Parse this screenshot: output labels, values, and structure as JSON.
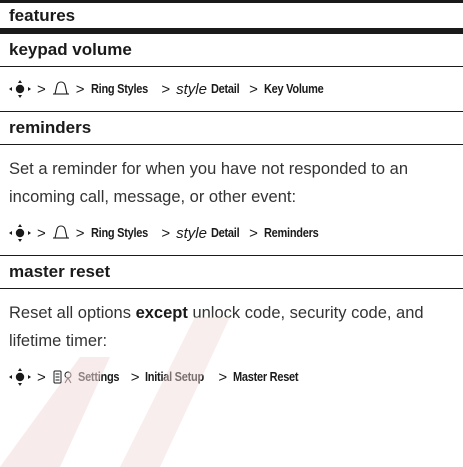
{
  "header": {
    "title": "features"
  },
  "sections": [
    {
      "title": "keypad volume",
      "body": "",
      "path": {
        "menu": "Ring Styles",
        "style_word": "style",
        "detail": "Detail",
        "target": "Key Volume"
      }
    },
    {
      "title": "reminders",
      "body": "Set a reminder for when you have not responded to an incoming call, message, or other event:",
      "path": {
        "menu": "Ring Styles",
        "style_word": "style",
        "detail": "Detail",
        "target": "Reminders"
      }
    },
    {
      "title": "master reset",
      "body_pre": "Reset all options ",
      "body_bold": "except",
      "body_post": " unlock code, security code, and lifetime timer:",
      "path": {
        "menu": "Settings",
        "detail": "Initial Setup",
        "target": "Master Reset"
      }
    }
  ],
  "separator": ">",
  "icons": {
    "nav": "nav-key-icon",
    "ring_styles": "ring-styles-icon",
    "settings": "settings-icon"
  },
  "colors": {
    "rule": "#1a1a1a",
    "text": "#333333",
    "watermark": "#f2dada"
  }
}
